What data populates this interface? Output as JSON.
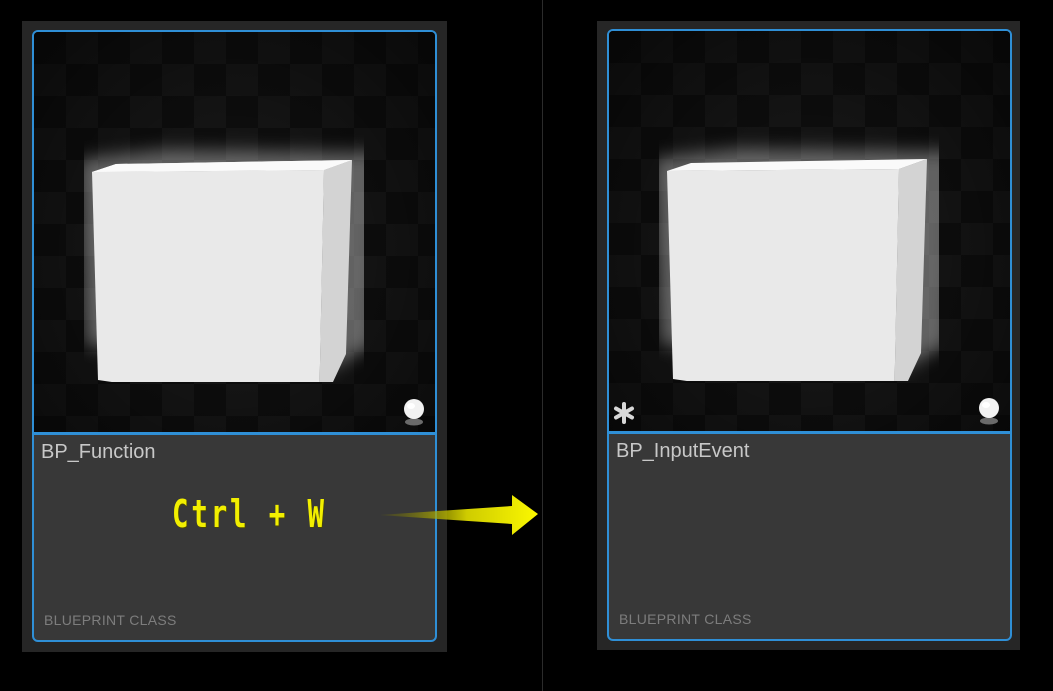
{
  "tiles": [
    {
      "name": "BP_Function",
      "type_label": "BLUEPRINT CLASS",
      "thumbnail_icon": "sphere-icon",
      "modified_marker": false
    },
    {
      "name": "BP_InputEvent",
      "type_label": "BLUEPRINT CLASS",
      "thumbnail_icon": "sphere-icon",
      "modified_marker": true,
      "modified_icon": "asterisk-icon"
    }
  ],
  "annotation": {
    "shortcut": "Ctrl + W",
    "arrow_icon": "right-arrow-icon",
    "color": "#f2ef00"
  },
  "colors": {
    "selection_border": "#2f8fd6",
    "tile_body": "#383838",
    "background": "#000000"
  }
}
